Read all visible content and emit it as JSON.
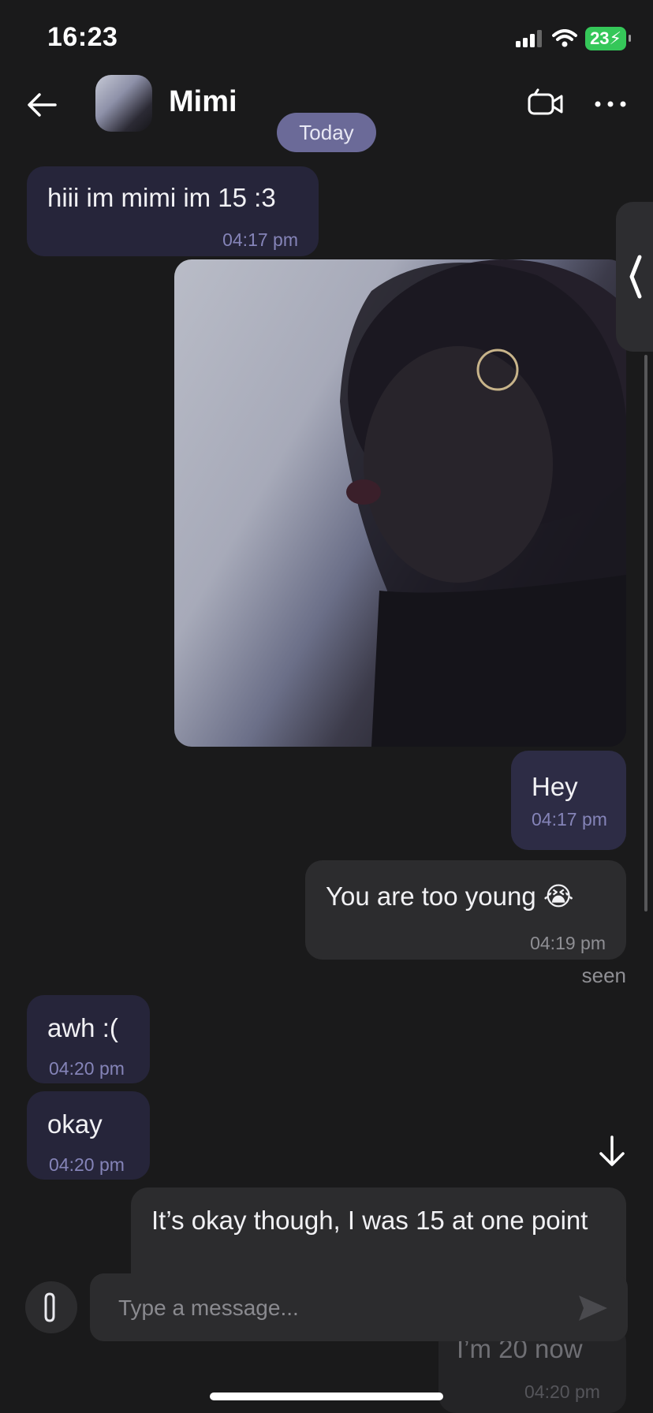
{
  "status_bar": {
    "time": "16:23",
    "battery": "23"
  },
  "header": {
    "contact_name": "Mimi"
  },
  "date_divider": "Today",
  "messages": [
    {
      "direction": "in",
      "text": "hiii im mimi im 15 :3",
      "time": "04:17 pm"
    },
    {
      "direction": "out",
      "type": "photo"
    },
    {
      "direction": "out",
      "text": "Hey",
      "time": "04:17 pm"
    },
    {
      "direction": "out",
      "text": "You are too young 😭",
      "time": "04:19 pm"
    },
    {
      "direction": "in",
      "text": "awh :(",
      "time": "04:20 pm"
    },
    {
      "direction": "in",
      "text": "okay",
      "time": "04:20 pm"
    },
    {
      "direction": "out",
      "text": "It’s okay though, I was 15 at one point"
    },
    {
      "direction": "out",
      "text": "I’m 20 now",
      "time": "04:20 pm"
    }
  ],
  "seen_label": "seen",
  "composer": {
    "placeholder": "Type a message..."
  },
  "colors": {
    "background": "#1a1a1b",
    "incoming": "#26253a",
    "outgoing": "#2c2c2e",
    "accent": "#6b6a98"
  },
  "icons": [
    "back-arrow-icon",
    "video-camera-icon",
    "more-icon",
    "chevron-left-icon",
    "arrow-down-icon",
    "paperclip-icon",
    "send-icon",
    "signal-icon",
    "wifi-icon",
    "battery-icon"
  ]
}
